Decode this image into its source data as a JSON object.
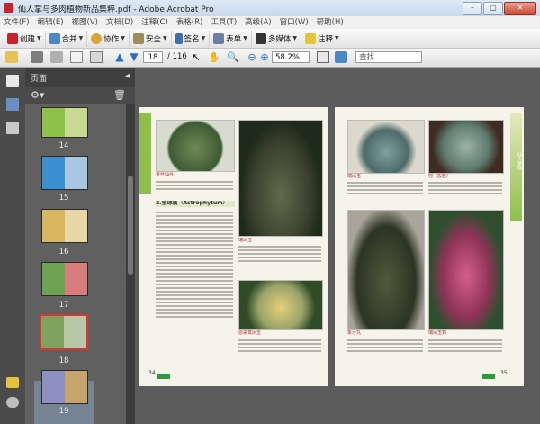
{
  "window": {
    "title": "仙人掌与多肉植物新品集粹.pdf - Adobe Acrobat Pro",
    "min": "–",
    "max": "▢",
    "close": "✕"
  },
  "menu": [
    "文件(F)",
    "编辑(E)",
    "视图(V)",
    "文档(D)",
    "注释(C)",
    "表格(R)",
    "工具(T)",
    "高级(A)",
    "窗口(W)",
    "帮助(H)"
  ],
  "toolbar": {
    "create": "创建",
    "combine": "合并",
    "collaborate": "协作",
    "secure": "安全",
    "sign": "签名",
    "forms": "表单",
    "multimedia": "多媒体",
    "comment": "注释"
  },
  "nav": {
    "current_page": "18",
    "total_pages": "/ 116",
    "zoom": "58.2%",
    "find_placeholder": "查找"
  },
  "panel": {
    "title": "页面"
  },
  "thumbnails": [
    {
      "label": "14",
      "colors": [
        "#8fc04a",
        "#c9d98f"
      ]
    },
    {
      "label": "15",
      "colors": [
        "#3a8fd1",
        "#a9c7e3"
      ]
    },
    {
      "label": "16",
      "colors": [
        "#d9b760",
        "#e8d7a6"
      ]
    },
    {
      "label": "17",
      "colors": [
        "#6ea152",
        "#d77d7d"
      ]
    },
    {
      "label": "18",
      "colors": [
        "#7ea35e",
        "#b8c7a8"
      ],
      "selected": true
    },
    {
      "label": "19",
      "colors": [
        "#8e8fc2",
        "#c5a46d"
      ]
    }
  ],
  "left_page": {
    "number": "34",
    "caption1": "金丝仙丹",
    "heading": "2.星球属（Astrophytum）",
    "caption2": "瑞凤玉",
    "caption3": "恩冢鸾凤玉"
  },
  "right_page": {
    "number": "35",
    "caption1": "瑞凤玉",
    "caption2": "兜（般若）",
    "caption3": "象牙丸",
    "caption4": "瑞凤玉锦",
    "side_label": "仙人掌科"
  },
  "colors": {
    "accent_green": "#2e9a3e",
    "selection": "#d33"
  }
}
